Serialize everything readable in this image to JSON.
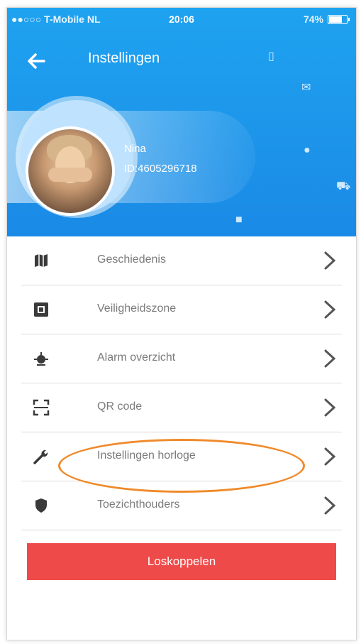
{
  "status_bar": {
    "carrier": "●●○○○ T-Mobile NL",
    "time": "20:06",
    "battery": "74%"
  },
  "header": {
    "title": "Instellingen",
    "back_icon": "arrow-left-icon"
  },
  "profile": {
    "name": "Nina",
    "id": "ID:4605296718"
  },
  "menu": {
    "items": [
      {
        "label": "Geschiedenis",
        "icon": "map-icon"
      },
      {
        "label": "Veiligheidszone",
        "icon": "zone-icon"
      },
      {
        "label": "Alarm overzicht",
        "icon": "alarm-icon"
      },
      {
        "label": "QR code",
        "icon": "qr-code-icon"
      },
      {
        "label": "Instellingen horloge",
        "icon": "wrench-icon"
      },
      {
        "label": "Toezichthouders",
        "icon": "shield-icon"
      }
    ]
  },
  "footer": {
    "disconnect_label": "Loskoppelen"
  },
  "colors": {
    "header_blue": "#1ea3f0",
    "button_red": "#ef4a4a",
    "highlight_orange": "#f08a2a"
  }
}
